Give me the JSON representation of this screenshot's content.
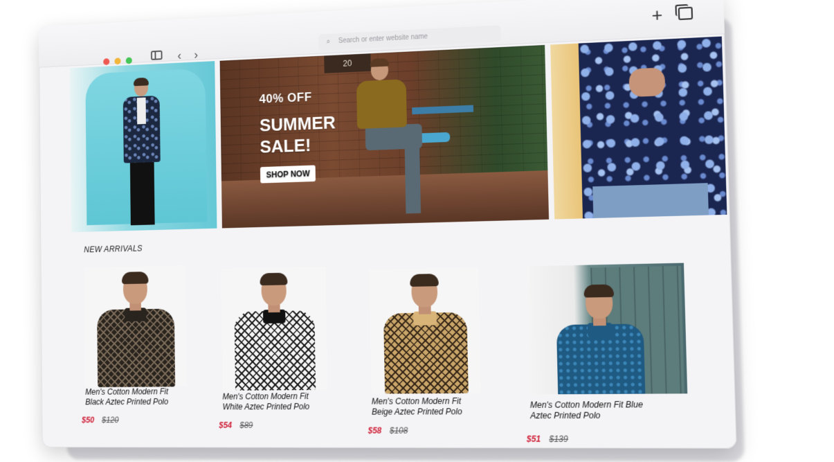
{
  "browser": {
    "address_placeholder": "Search or enter website name",
    "new_tab_glyph": "+",
    "back_glyph": "‹",
    "forward_glyph": "›",
    "search_glyph": "⌕"
  },
  "hero": {
    "sign_text": "20",
    "discount": "40% OFF",
    "title_line1": "SUMMER",
    "title_line2": "SALE!",
    "cta": "SHOP NOW"
  },
  "section": {
    "title": "NEW ARRIVALS"
  },
  "products": [
    {
      "name_line1": "Men's Cotton Modern Fit",
      "name_line2": "Black Aztec Printed Polo",
      "price": "$50",
      "old_price": "$120"
    },
    {
      "name_line1": "Men's Cotton Modern Fit",
      "name_line2": "White Aztec Printed Polo",
      "price": "$54",
      "old_price": "$89"
    },
    {
      "name_line1": "Men's Cotton Modern Fit",
      "name_line2": "Beige Aztec Printed Polo",
      "price": "$58",
      "old_price": "$108"
    },
    {
      "name_line1": "Men's Cotton Modern Fit Blue",
      "name_line2": "Aztec Printed Polo",
      "price": "$51",
      "old_price": "$139"
    }
  ],
  "colors": {
    "price_red": "#d0223a",
    "traffic_red": "#ee5a52",
    "traffic_yellow": "#f1b63b",
    "traffic_green": "#46c656"
  }
}
